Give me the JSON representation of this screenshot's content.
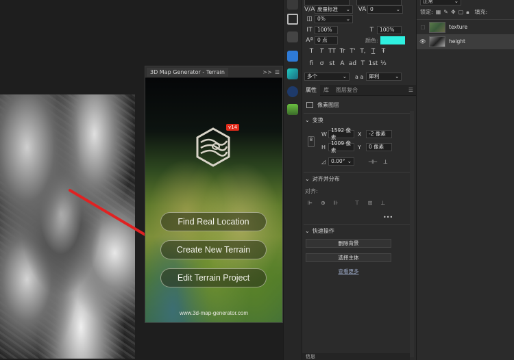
{
  "plugin": {
    "tab_title": "3D Map Generator - Terrain",
    "controls": ">>",
    "version_badge": "v14",
    "buttons": {
      "find_real_location": "Find Real Location",
      "create_new_terrain": "Create New Terrain",
      "edit_terrain_project": "Edit Terrain Project"
    },
    "website": "www.3d-map-generator.com"
  },
  "character": {
    "tracking_method": "度量标准",
    "tracking_value": "0",
    "kerning": "0%",
    "vertical_scale": "100%",
    "horizontal_scale": "100%",
    "baseline_shift": "0 点",
    "color_label": "颜色:",
    "color_value": "#2ff0e0",
    "language": "多个",
    "antialias_prefix": "a a",
    "antialias": "犀利",
    "style_glyphs_row1": [
      "T",
      "T",
      "TT",
      "Tr",
      "T'",
      "T,",
      "T",
      "Ŧ"
    ],
    "style_glyphs_row2": [
      "fi",
      "ơ",
      "st",
      "A",
      "ad",
      "T",
      "1st",
      "½"
    ]
  },
  "properties": {
    "tabs": [
      "属性",
      "库",
      "图层复合"
    ],
    "layer_type": "像素图层",
    "transform": {
      "title": "变换",
      "w_label": "W",
      "w_value": "1592 像素",
      "x_label": "X",
      "x_value": "-2 像素",
      "h_label": "H",
      "h_value": "1009 像素",
      "y_label": "Y",
      "y_value": "0 像素",
      "angle": "0.00°"
    },
    "align": {
      "title": "对齐并分布",
      "label": "对齐:",
      "more": "•••"
    },
    "quick_actions": {
      "title": "快速操作",
      "remove_bg": "删除背景",
      "select_subject": "选择主体",
      "see_more": "查看更多"
    },
    "bottom_tab": "信息"
  },
  "layers": {
    "blend_mode": "正常",
    "lock_label": "锁定:",
    "fill_label": "填充:",
    "items": [
      {
        "name": "texture",
        "visible": false
      },
      {
        "name": "height",
        "visible": true
      }
    ]
  },
  "colors": {
    "arrow": "#e02222",
    "accent": "#2ff0e0",
    "badge": "#e02b1a"
  }
}
